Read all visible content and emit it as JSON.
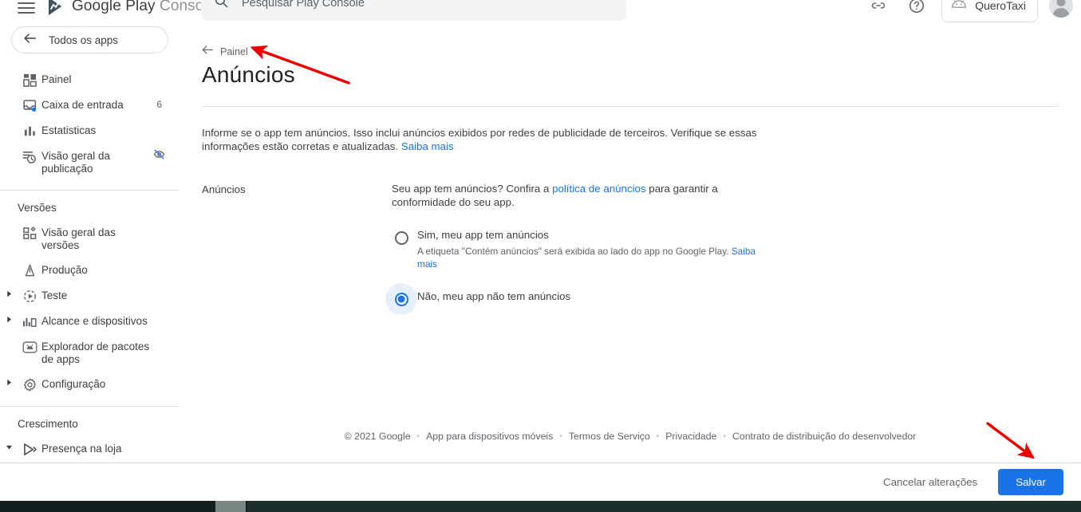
{
  "topbar": {
    "menu_icon": "hamburger-menu-icon",
    "brand_first": "Google Play",
    "brand_second": "Console",
    "search_placeholder": "Pesquisar Play Console",
    "search_icon": "search-icon",
    "link_icon": "link-icon",
    "help_icon": "help-circle-icon",
    "app_chip_label": "QueroTaxi",
    "app_chip_icon": "android-robot-icon",
    "avatar_icon": "user-avatar-icon"
  },
  "sidebar": {
    "all_apps_label": "Todos os apps",
    "all_apps_icon": "arrow-left-icon",
    "items": [
      {
        "label": "Painel",
        "icon": "dashboard-grid-icon",
        "badge": "",
        "caret": false
      },
      {
        "label": "Caixa de entrada",
        "icon": "inbox-icon",
        "badge": "6",
        "caret": false
      },
      {
        "label": "Estatisticas",
        "icon": "bar-chart-icon",
        "badge": "",
        "caret": false
      },
      {
        "label": "Visão geral da publicação",
        "icon": "publishing-clock-icon",
        "badge": "",
        "caret": false,
        "trailing_icon": "eye-off-icon"
      }
    ],
    "section_versions": "Versões",
    "version_items": [
      {
        "label": "Visão geral das versões",
        "icon": "releases-grid-icon",
        "caret": false
      },
      {
        "label": "Produção",
        "icon": "production-rocket-icon",
        "caret": false
      },
      {
        "label": "Teste",
        "icon": "testing-play-icon",
        "caret": true
      },
      {
        "label": "Alcance e dispositivos",
        "icon": "reach-devices-icon",
        "caret": true
      },
      {
        "label": "Explorador de pacotes de apps",
        "icon": "app-bundle-explorer-icon",
        "caret": false
      },
      {
        "label": "Configuração",
        "icon": "gear-icon",
        "caret": true
      }
    ],
    "section_growth": "Crescimento",
    "growth_items": [
      {
        "label": "Presença na loja",
        "icon": "store-presence-play-icon",
        "caret": true,
        "expanded": true
      }
    ]
  },
  "main": {
    "back_label": "Painel",
    "back_icon": "arrow-left-icon",
    "page_title": "Anúncios",
    "intro_text_1": "Informe se o app tem anúncios. Isso inclui anúncios exibidos por redes de publicidade de terceiros. Verifique se essas informações estão corretas e atualizadas. ",
    "intro_link": "Saiba mais",
    "field_label": "Anúncios",
    "field_desc_1": "Seu app tem anúncios? Confira a ",
    "field_desc_link": "política de anúncios",
    "field_desc_2": " para garantir a conformidade do seu app.",
    "radios": [
      {
        "label": "Sim, meu app tem anúncios",
        "sub_text": "A etiqueta \"Contém anúncios\" será exibida ao lado do app no Google Play. ",
        "sub_link": "Saiba mais",
        "selected": false
      },
      {
        "label": "Não, meu app não tem anúncios",
        "sub_text": "",
        "sub_link": "",
        "selected": true
      }
    ]
  },
  "footer": {
    "copyright": "© 2021 Google",
    "links": [
      "App para dispositivos móveis",
      "Termos de Serviço",
      "Privacidade",
      "Contrato de distribuição do desenvolvedor"
    ],
    "separator": "•"
  },
  "actionbar": {
    "cancel_label": "Cancelar alterações",
    "save_label": "Salvar"
  },
  "annotations": {
    "arrow_color": "#ee0000",
    "arrow_top_name": "red-arrow-pointing-to-breadcrumb",
    "arrow_bottom_name": "red-arrow-pointing-to-save-button"
  },
  "colors": {
    "accent_blue": "#1a73e8",
    "link_blue": "#1a73e8",
    "text_primary": "#3c4043",
    "text_secondary": "#5f6368",
    "divider": "#e0e0e0",
    "radio_halo": "#e8f0fe",
    "taskbar": "#12211f"
  }
}
